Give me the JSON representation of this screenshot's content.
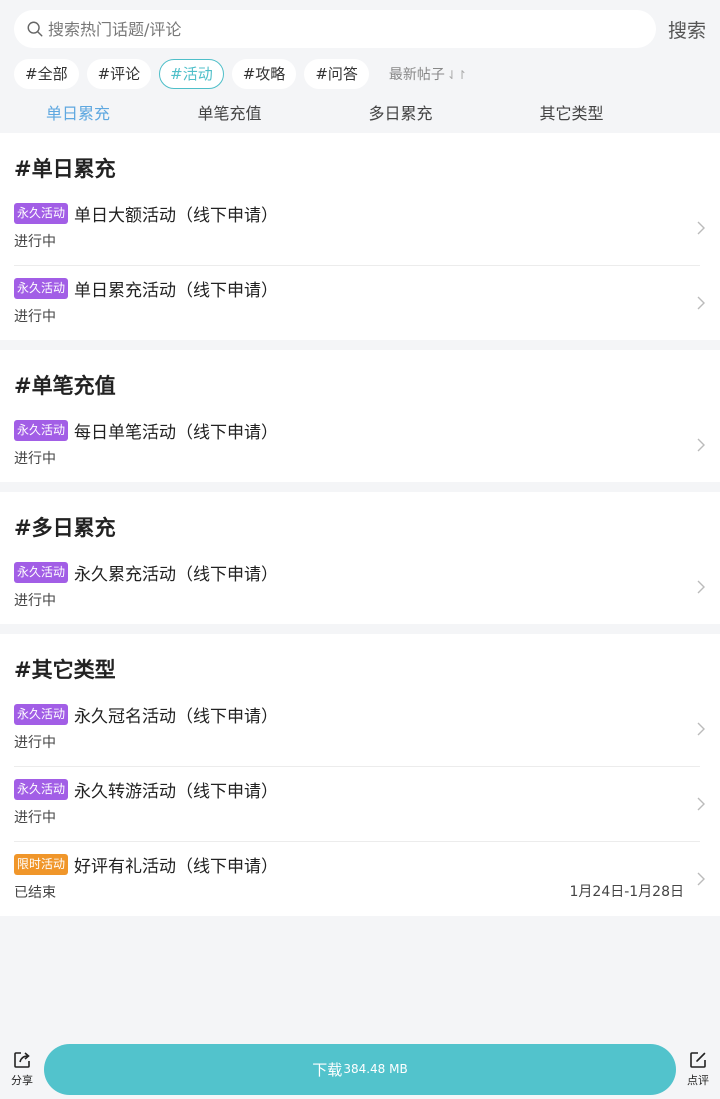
{
  "search": {
    "placeholder": "搜索热门话题/评论",
    "button_label": "搜索"
  },
  "chips": [
    {
      "label": "#全部",
      "active": false
    },
    {
      "label": "#评论",
      "active": false
    },
    {
      "label": "#活动",
      "active": true
    },
    {
      "label": "#攻略",
      "active": false
    },
    {
      "label": "#问答",
      "active": false
    }
  ],
  "sort_label": "最新帖子",
  "tabs": [
    {
      "label": "单日累充",
      "active": true
    },
    {
      "label": "单笔充值",
      "active": false
    },
    {
      "label": "多日累充",
      "active": false
    },
    {
      "label": "其它类型",
      "active": false
    }
  ],
  "colors": {
    "accent": "#4fbfc9",
    "tab_active": "#5fa8e0",
    "badge_permanent": "#a25ee6",
    "badge_limited": "#f0962a",
    "download": "#52c3cc"
  },
  "sections": [
    {
      "title": "#单日累充",
      "items": [
        {
          "badge": "永久活动",
          "badge_type": "permanent",
          "title": "单日大额活动（线下申请）",
          "status": "进行中"
        },
        {
          "badge": "永久活动",
          "badge_type": "permanent",
          "title": "单日累充活动（线下申请）",
          "status": "进行中"
        }
      ]
    },
    {
      "title": "#单笔充值",
      "items": [
        {
          "badge": "永久活动",
          "badge_type": "permanent",
          "title": "每日单笔活动（线下申请）",
          "status": "进行中"
        }
      ]
    },
    {
      "title": "#多日累充",
      "items": [
        {
          "badge": "永久活动",
          "badge_type": "permanent",
          "title": "永久累充活动（线下申请）",
          "status": "进行中"
        }
      ]
    },
    {
      "title": "#其它类型",
      "items": [
        {
          "badge": "永久活动",
          "badge_type": "permanent",
          "title": "永久冠名活动（线下申请）",
          "status": "进行中"
        },
        {
          "badge": "永久活动",
          "badge_type": "permanent",
          "title": "永久转游活动（线下申请）",
          "status": "进行中"
        },
        {
          "badge": "限时活动",
          "badge_type": "limited",
          "title": "好评有礼活动（线下申请）",
          "status": "已结束",
          "date": "1月24日-1月28日"
        }
      ]
    }
  ],
  "bottom": {
    "share_label": "分享",
    "download_label": "下载",
    "download_size": "384.48 MB",
    "review_label": "点评"
  }
}
